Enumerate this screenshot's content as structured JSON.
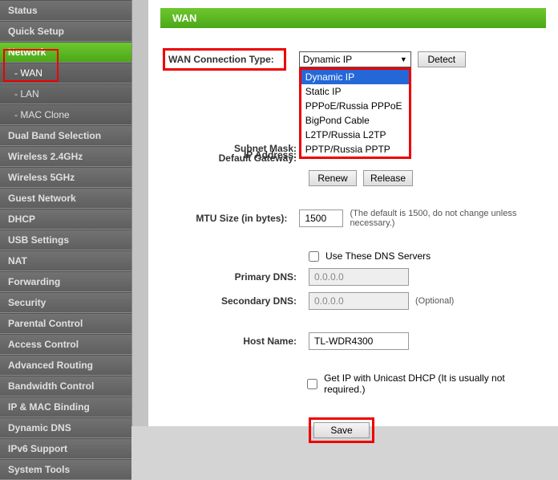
{
  "sidebar": {
    "items": [
      {
        "label": "Status",
        "active": false,
        "indent": false
      },
      {
        "label": "Quick Setup",
        "active": false,
        "indent": false
      },
      {
        "label": "Network",
        "active": true,
        "indent": false
      },
      {
        "label": "- WAN",
        "active": true,
        "indent": true
      },
      {
        "label": "- LAN",
        "active": false,
        "indent": true
      },
      {
        "label": "- MAC Clone",
        "active": false,
        "indent": true
      },
      {
        "label": "Dual Band Selection",
        "active": false,
        "indent": false
      },
      {
        "label": "Wireless 2.4GHz",
        "active": false,
        "indent": false
      },
      {
        "label": "Wireless 5GHz",
        "active": false,
        "indent": false
      },
      {
        "label": "Guest Network",
        "active": false,
        "indent": false
      },
      {
        "label": "DHCP",
        "active": false,
        "indent": false
      },
      {
        "label": "USB Settings",
        "active": false,
        "indent": false
      },
      {
        "label": "NAT",
        "active": false,
        "indent": false
      },
      {
        "label": "Forwarding",
        "active": false,
        "indent": false
      },
      {
        "label": "Security",
        "active": false,
        "indent": false
      },
      {
        "label": "Parental Control",
        "active": false,
        "indent": false
      },
      {
        "label": "Access Control",
        "active": false,
        "indent": false
      },
      {
        "label": "Advanced Routing",
        "active": false,
        "indent": false
      },
      {
        "label": "Bandwidth Control",
        "active": false,
        "indent": false
      },
      {
        "label": "IP & MAC Binding",
        "active": false,
        "indent": false
      },
      {
        "label": "Dynamic DNS",
        "active": false,
        "indent": false
      },
      {
        "label": "IPv6 Support",
        "active": false,
        "indent": false
      },
      {
        "label": "System Tools",
        "active": false,
        "indent": false
      }
    ]
  },
  "page": {
    "title": "WAN"
  },
  "wan": {
    "connection_label": "WAN Connection Type:",
    "connection_value": "Dynamic IP",
    "detect_label": "Detect",
    "options": [
      "Dynamic IP",
      "Static IP",
      "PPPoE/Russia PPPoE",
      "BigPond Cable",
      "L2TP/Russia L2TP",
      "PPTP/Russia PPTP"
    ],
    "ip_label": "IP Address:",
    "subnet_label": "Subnet Mask:",
    "gateway_label": "Default Gateway:",
    "renew_label": "Renew",
    "release_label": "Release",
    "mtu_label": "MTU Size (in bytes):",
    "mtu_value": "1500",
    "mtu_note": "(The default is 1500, do not change unless necessary.)",
    "dns_check_label": "Use These DNS Servers",
    "primary_dns_label": "Primary DNS:",
    "primary_dns_value": "0.0.0.0",
    "secondary_dns_label": "Secondary DNS:",
    "secondary_dns_value": "0.0.0.0",
    "optional_note": "(Optional)",
    "host_label": "Host Name:",
    "host_value": "TL-WDR4300",
    "unicast_label": "Get IP with Unicast DHCP (It is usually not required.)",
    "save_label": "Save"
  }
}
